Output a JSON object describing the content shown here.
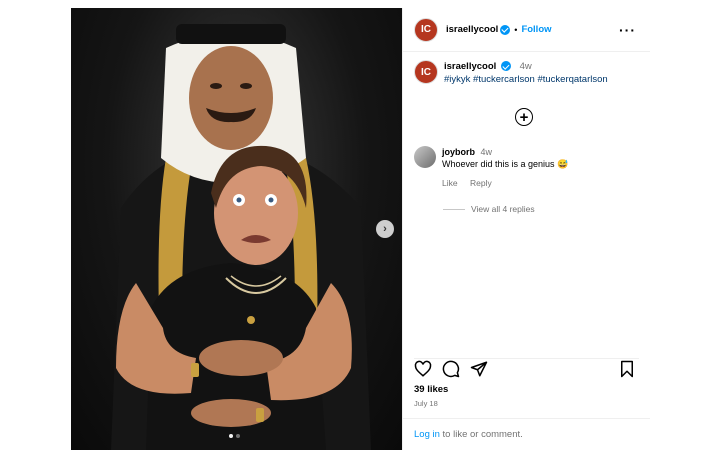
{
  "header": {
    "username": "israellycool",
    "follow_label": "Follow",
    "more_icon": "more-options-icon"
  },
  "caption": {
    "username": "israellycool",
    "time": "4w",
    "hashtags": "#iykyk #tuckercarlson #tuckerqatarlson"
  },
  "comment": {
    "username": "joyborb",
    "time": "4w",
    "text": "Whoever did this is a genius 😅",
    "like_label": "Like",
    "reply_label": "Reply",
    "view_replies": "View all 4 replies"
  },
  "actions": {
    "like_icon": "heart-icon",
    "comment_icon": "comment-icon",
    "share_icon": "share-icon",
    "save_icon": "bookmark-icon"
  },
  "likes": "39 likes",
  "date": "July 18",
  "login": {
    "link": "Log in",
    "rest": " to like or comment."
  },
  "carousel": {
    "next_icon": "chevron-right-icon",
    "total": 2,
    "current": 1
  },
  "colors": {
    "accent": "#0095f6",
    "avatar": "#b5361f"
  }
}
